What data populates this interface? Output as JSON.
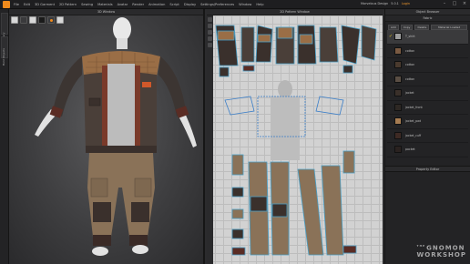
{
  "menubar": {
    "items": [
      "File",
      "Edit",
      "3D Garment",
      "2D Pattern",
      "Sewing",
      "Materials",
      "Avatar",
      "Render",
      "Animation",
      "Script",
      "Display",
      "Settings/Preferences",
      "Window",
      "Help"
    ],
    "right_label": "Marvelous Design",
    "right_value": "5.0.1",
    "right_accent": "Login"
  },
  "left_tabs": [
    "Library",
    "Hold Objects"
  ],
  "view3d": {
    "title": "3D Window"
  },
  "view2d": {
    "title": "2D Pattern Window"
  },
  "right_panel": {
    "title": "Object Browser",
    "tabs_header": "Fabric",
    "buttons": [
      "Add",
      "Copy",
      "Delete",
      "Material Loaded"
    ],
    "fabrics": [
      {
        "name": "T_shirt",
        "color": "#9c9c9c",
        "selected": true
      },
      {
        "name": "cotton",
        "color": "#7a5a42",
        "selected": false
      },
      {
        "name": "cotton",
        "color": "#4a3a2e",
        "selected": false
      },
      {
        "name": "cotton",
        "color": "#5a4e44",
        "selected": false
      },
      {
        "name": "jacket",
        "color": "#3a302a",
        "selected": false
      },
      {
        "name": "jacket_front",
        "color": "#2e2824",
        "selected": false
      },
      {
        "name": "jacket_pad",
        "color": "#a67c52",
        "selected": false
      },
      {
        "name": "jacket_cuff",
        "color": "#3e2a24",
        "selected": false
      },
      {
        "name": "pocket",
        "color": "#2a2220",
        "selected": false
      }
    ],
    "properties_title": "Property Editor"
  },
  "watermark": {
    "the": "THE",
    "line1": "GNOMON",
    "line2": "WORKSHOP"
  },
  "colors": {
    "accent": "#f08a1c",
    "panel": "#232325",
    "canvas2d": "#d2d2d2"
  }
}
